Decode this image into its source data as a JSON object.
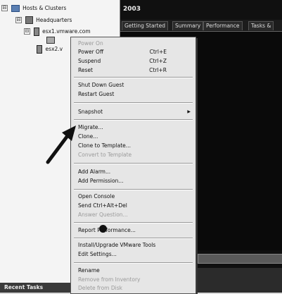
{
  "tree": {
    "root_label": "Hosts & Clusters",
    "datacenter_label": "Headquarters",
    "host1_label": "esx1.vmware.com",
    "host2_label": "esx2.v",
    "expander_symbol": "⊟"
  },
  "right_panel": {
    "vm_title": "2003",
    "tabs": [
      "Getting Started",
      "Summary",
      "Performance",
      "Tasks &"
    ]
  },
  "context_menu": {
    "power_on": "Power On",
    "power_off": "Power Off",
    "power_off_shortcut": "Ctrl+E",
    "suspend": "Suspend",
    "suspend_shortcut": "Ctrl+Z",
    "reset": "Reset",
    "reset_shortcut": "Ctrl+R",
    "shut_down_guest": "Shut Down Guest",
    "restart_guest": "Restart Guest",
    "snapshot": "Snapshot",
    "migrate": "Migrate...",
    "clone": "Clone...",
    "clone_to_template": "Clone to Template...",
    "convert_to_template": "Convert to Template",
    "add_alarm": "Add Alarm...",
    "add_permission": "Add Permission...",
    "open_console": "Open Console",
    "send_ctrl_alt_del": "Send Ctrl+Alt+Del",
    "answer_question": "Answer Question...",
    "report_performance": "Report Performance...",
    "install_vmware_tools": "Install/Upgrade VMware Tools",
    "edit_settings": "Edit Settings...",
    "rename": "Rename",
    "remove_from_inventory": "Remove from Inventory",
    "delete_from_disk": "Delete from Disk",
    "submenu_arrow": "▶"
  },
  "bottom": {
    "recent_tasks": "Recent Tasks"
  },
  "colors": {
    "tree_bg": "#f4f4f4",
    "menu_bg": "#e6e6e6",
    "disabled_text": "#9a9a9a",
    "console_bg": "#0a0a0a"
  }
}
